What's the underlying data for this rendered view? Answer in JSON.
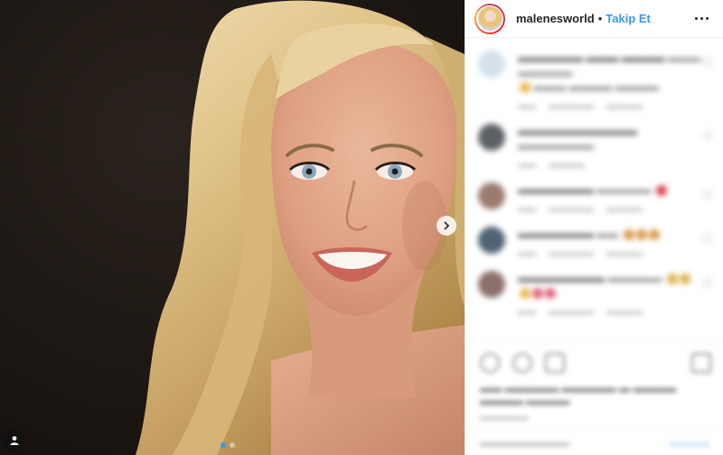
{
  "header": {
    "username": "malenesworld",
    "separator": "•",
    "follow_label": "Takip Et"
  },
  "media": {
    "carousel_total": 2,
    "carousel_active": 1
  },
  "colors": {
    "accent": "#3897f0",
    "text": "#262626",
    "border": "#efefef"
  },
  "comments": [
    {
      "avatar_color": "#d3e1ec",
      "text": ""
    },
    {
      "avatar_color": "#5d6166",
      "text": ""
    },
    {
      "avatar_color": "#9b7a70",
      "text": ""
    },
    {
      "avatar_color": "#4f6372",
      "text": ""
    },
    {
      "avatar_color": "#8b6f6a",
      "text": ""
    }
  ],
  "icons": [
    "next-chevron-icon",
    "user-tag-icon",
    "more-options-icon",
    "heart-icon",
    "comment-icon",
    "share-icon",
    "bookmark-icon"
  ]
}
